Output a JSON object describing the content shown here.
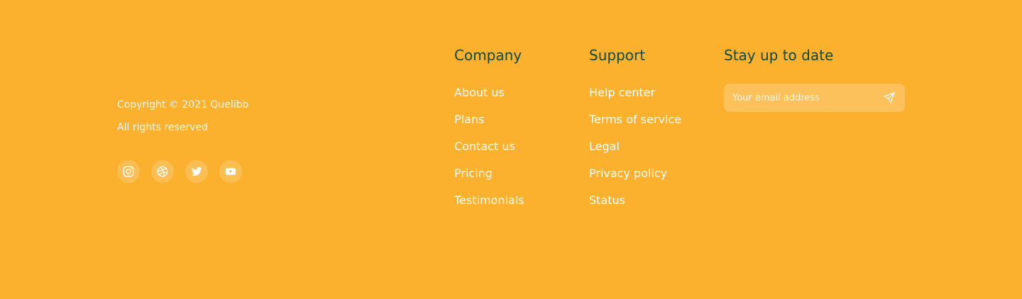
{
  "brand": {
    "copyright": "Copyright © 2021 Quelibb",
    "rights": "All rights reserved",
    "socials": [
      {
        "icon": "instagram-icon"
      },
      {
        "icon": "dribbble-icon"
      },
      {
        "icon": "twitter-icon"
      },
      {
        "icon": "youtube-icon"
      }
    ]
  },
  "company": {
    "title": "Company",
    "links": [
      "About us",
      "Plans",
      "Contact us",
      "Pricing",
      "Testimonials"
    ]
  },
  "support": {
    "title": "Support",
    "links": [
      "Help center",
      "Terms of service",
      "Legal",
      "Privacy policy",
      "Status"
    ]
  },
  "newsletter": {
    "title": "Stay up to date",
    "placeholder": "Your email address",
    "send_icon": "send-icon"
  },
  "colors": {
    "background": "#FBB02E",
    "heading": "#0E4A3C",
    "link": "#FFFFFF"
  }
}
